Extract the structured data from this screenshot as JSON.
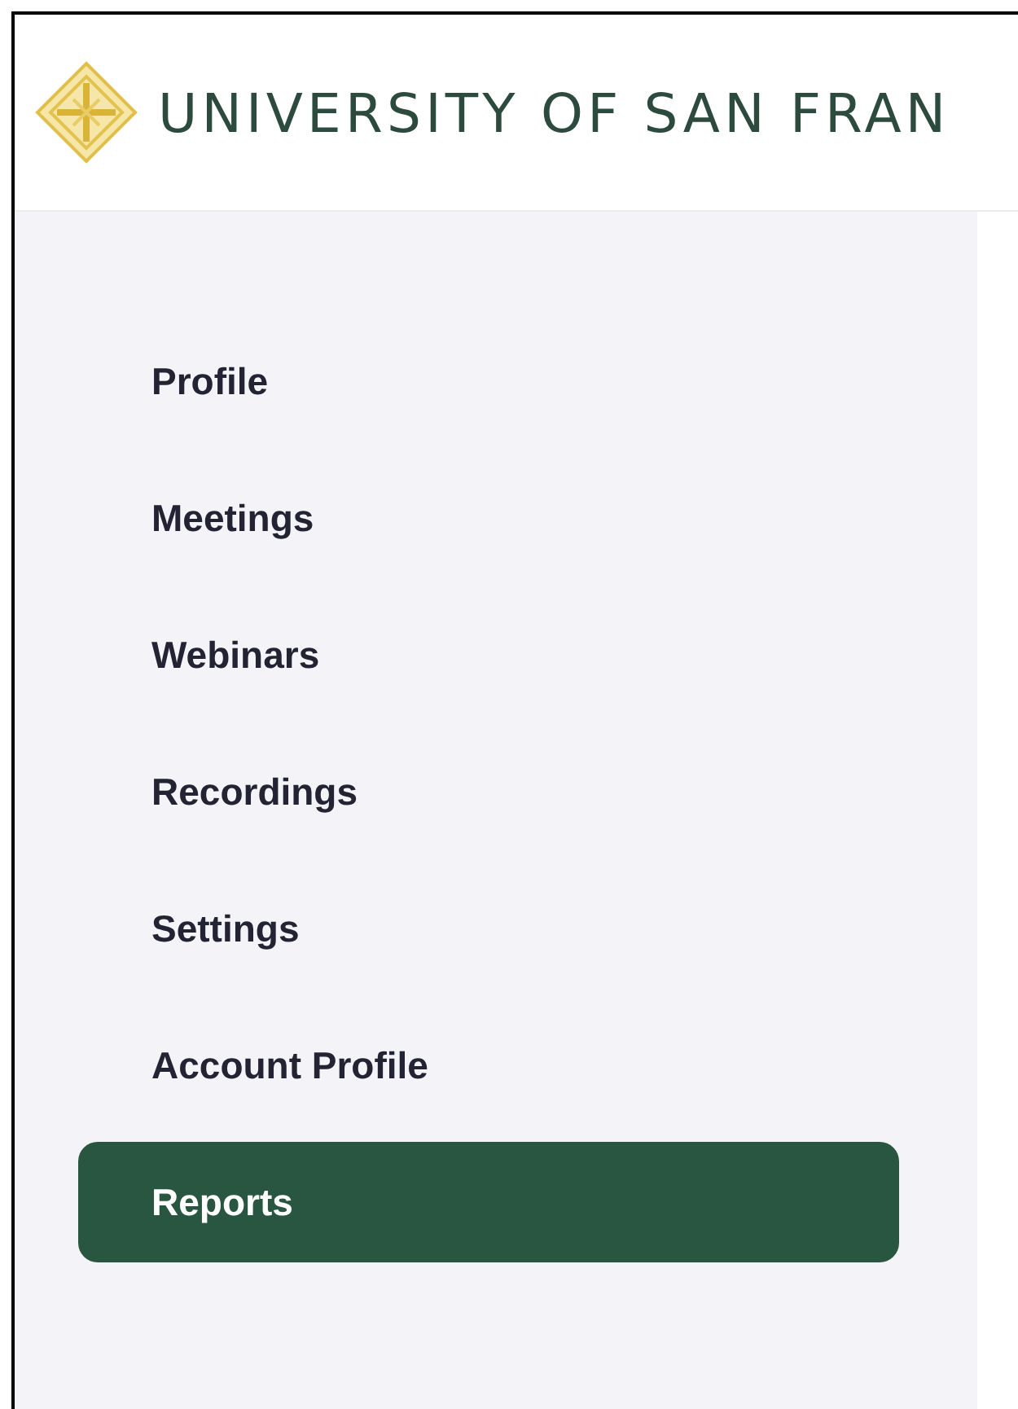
{
  "header": {
    "logo_text": "UNIVERSITY OF SAN FRAN"
  },
  "sidebar": {
    "items": [
      {
        "label": "Profile",
        "selected": false
      },
      {
        "label": "Meetings",
        "selected": false
      },
      {
        "label": "Webinars",
        "selected": false
      },
      {
        "label": "Recordings",
        "selected": false
      },
      {
        "label": "Settings",
        "selected": false
      },
      {
        "label": "Account Profile",
        "selected": false
      },
      {
        "label": "Reports",
        "selected": true
      }
    ]
  }
}
